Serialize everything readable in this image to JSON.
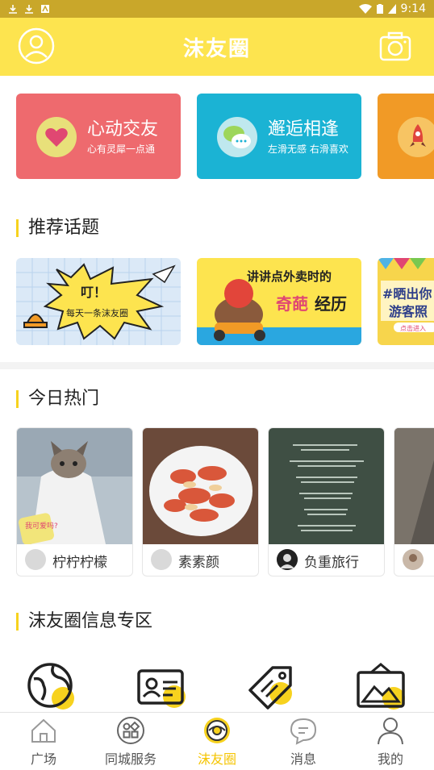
{
  "status_bar": {
    "time": "9:14"
  },
  "header": {
    "title": "沫友圈"
  },
  "feature_cards": [
    {
      "title": "心动交友",
      "subtitle": "心有灵犀一点通",
      "icon": "heart-icon",
      "color": "#ee6a6e"
    },
    {
      "title": "邂逅相逢",
      "subtitle": "左滑无感 右滑喜欢",
      "icon": "chat-bubbles-icon",
      "color": "#1bb3d4"
    },
    {
      "title": "",
      "subtitle": "",
      "icon": "rocket-icon",
      "color": "#f19a26"
    }
  ],
  "sections": {
    "topics": "推荐话题",
    "hot": "今日热门",
    "info": "沫友圈信息专区"
  },
  "topics": [
    {
      "line1": "叮！",
      "line2": "每天一条沫友圈"
    },
    {
      "line1": "讲讲点外卖时的",
      "line2a": "奇葩",
      "line2b": "经历"
    },
    {
      "line1": "#晒出你",
      "line2": "游客照",
      "badge": "点击进入"
    }
  ],
  "hot_posts": [
    {
      "user": "柠柠柠檬",
      "sticker": "我可爱吗?"
    },
    {
      "user": "素素颜"
    },
    {
      "user": "负重旅行"
    },
    {
      "user": ""
    }
  ],
  "tabs": [
    {
      "label": "广场",
      "icon": "home-icon"
    },
    {
      "label": "同城服务",
      "icon": "grid-icon"
    },
    {
      "label": "沫友圈",
      "icon": "eye-icon",
      "active": true
    },
    {
      "label": "消息",
      "icon": "message-icon"
    },
    {
      "label": "我的",
      "icon": "user-icon"
    }
  ],
  "colors": {
    "accent": "#fde44f",
    "active_tab": "#f5c400"
  }
}
